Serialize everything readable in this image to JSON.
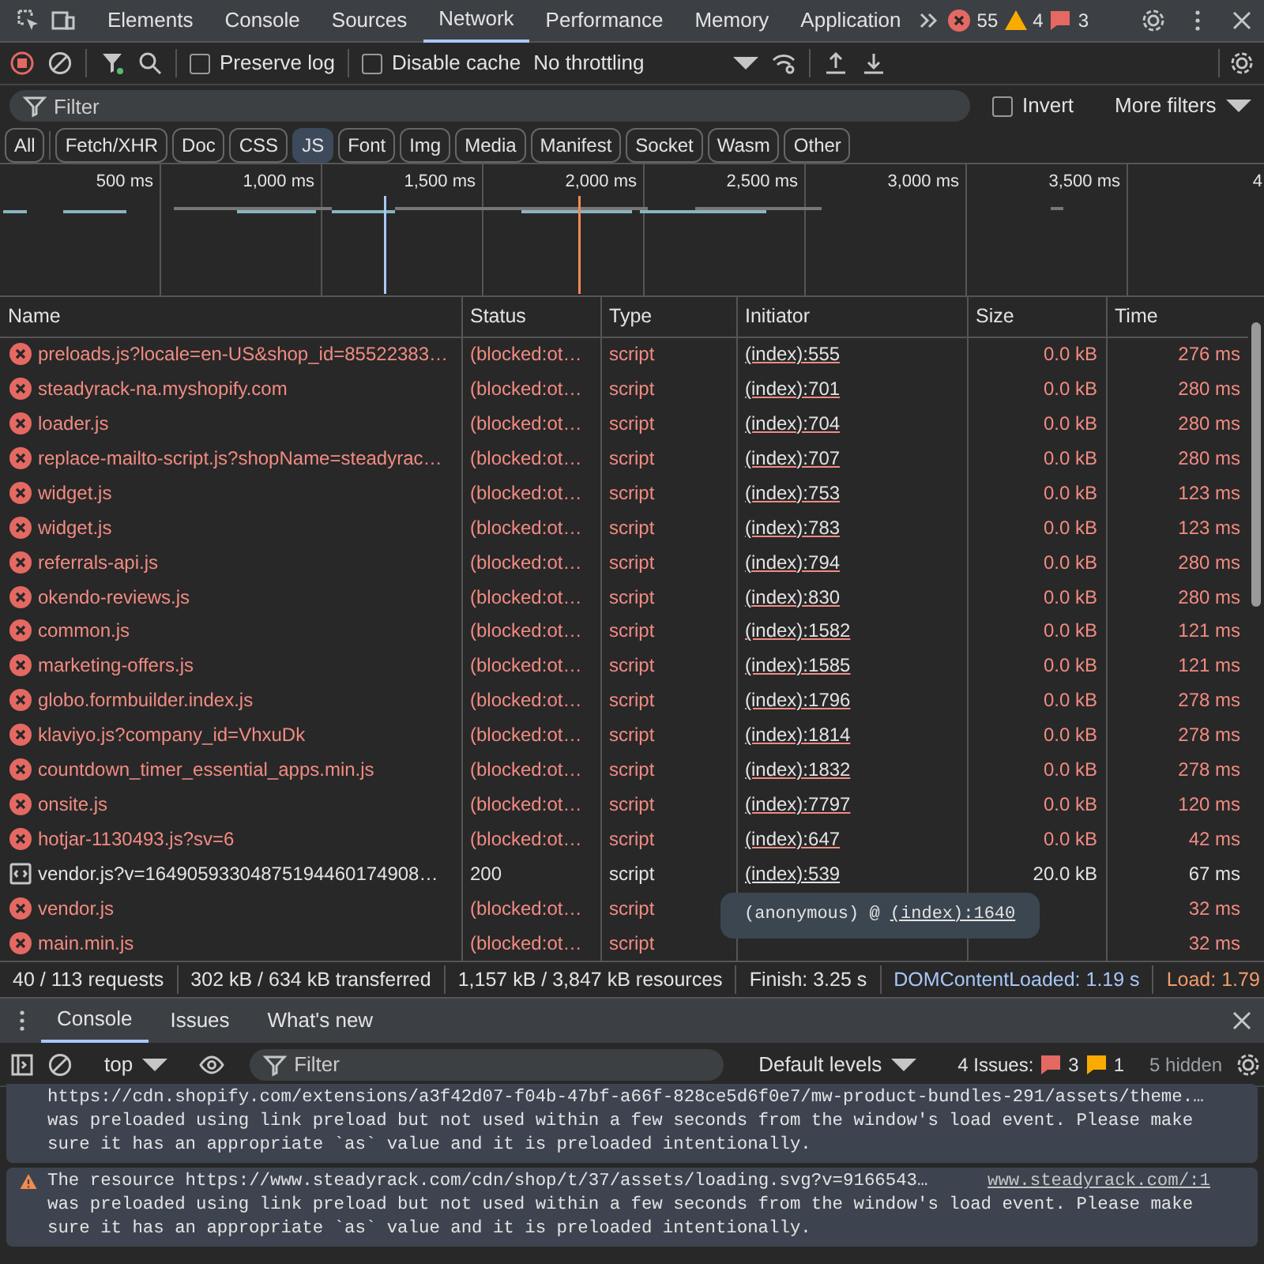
{
  "top_tabs": [
    {
      "label": "Elements",
      "selected": false
    },
    {
      "label": "Console",
      "selected": false
    },
    {
      "label": "Sources",
      "selected": false
    },
    {
      "label": "Network",
      "selected": true
    },
    {
      "label": "Performance",
      "selected": false
    },
    {
      "label": "Memory",
      "selected": false
    },
    {
      "label": "Application",
      "selected": false
    }
  ],
  "counts": {
    "errors": "55",
    "warnings": "4",
    "info": "3"
  },
  "toolbar": {
    "preserve_log": {
      "label": "Preserve log",
      "checked": false
    },
    "disable_cache": {
      "label": "Disable cache",
      "checked": false
    },
    "throttling": "No throttling"
  },
  "filter_bar": {
    "placeholder": "Filter",
    "invert": {
      "label": "Invert",
      "checked": false
    },
    "more_filters": "More filters"
  },
  "type_filters": [
    {
      "label": "All",
      "selected": false
    },
    {
      "label": "Fetch/XHR",
      "selected": false
    },
    {
      "label": "Doc",
      "selected": false
    },
    {
      "label": "CSS",
      "selected": false
    },
    {
      "label": "JS",
      "selected": true
    },
    {
      "label": "Font",
      "selected": false
    },
    {
      "label": "Img",
      "selected": false
    },
    {
      "label": "Media",
      "selected": false
    },
    {
      "label": "Manifest",
      "selected": false
    },
    {
      "label": "Socket",
      "selected": false
    },
    {
      "label": "Wasm",
      "selected": false
    },
    {
      "label": "Other",
      "selected": false
    }
  ],
  "overview": {
    "tick_labels": [
      "500 ms",
      "1,000 ms",
      "1,500 ms",
      "2,000 ms",
      "2,500 ms",
      "3,000 ms",
      "3,500 ms",
      "4"
    ]
  },
  "table": {
    "columns": [
      "Name",
      "Status",
      "Type",
      "Initiator",
      "Size",
      "Time"
    ],
    "rows": [
      {
        "kind": "error",
        "name": "preloads.js?locale=en-US&shop_id=85522383…",
        "status": "(blocked:ot…",
        "type": "script",
        "initiator": "(index):555",
        "size": "0.0 kB",
        "time": "276 ms"
      },
      {
        "kind": "error",
        "name": "steadyrack-na.myshopify.com",
        "status": "(blocked:ot…",
        "type": "script",
        "initiator": "(index):701",
        "size": "0.0 kB",
        "time": "280 ms"
      },
      {
        "kind": "error",
        "name": "loader.js",
        "status": "(blocked:ot…",
        "type": "script",
        "initiator": "(index):704",
        "size": "0.0 kB",
        "time": "280 ms"
      },
      {
        "kind": "error",
        "name": "replace-mailto-script.js?shopName=steadyrac…",
        "status": "(blocked:ot…",
        "type": "script",
        "initiator": "(index):707",
        "size": "0.0 kB",
        "time": "280 ms"
      },
      {
        "kind": "error",
        "name": "widget.js",
        "status": "(blocked:ot…",
        "type": "script",
        "initiator": "(index):753",
        "size": "0.0 kB",
        "time": "123 ms"
      },
      {
        "kind": "error",
        "name": "widget.js",
        "status": "(blocked:ot…",
        "type": "script",
        "initiator": "(index):783",
        "size": "0.0 kB",
        "time": "123 ms"
      },
      {
        "kind": "error",
        "name": "referrals-api.js",
        "status": "(blocked:ot…",
        "type": "script",
        "initiator": "(index):794",
        "size": "0.0 kB",
        "time": "280 ms"
      },
      {
        "kind": "error",
        "name": "okendo-reviews.js",
        "status": "(blocked:ot…",
        "type": "script",
        "initiator": "(index):830",
        "size": "0.0 kB",
        "time": "280 ms"
      },
      {
        "kind": "error",
        "name": "common.js",
        "status": "(blocked:ot…",
        "type": "script",
        "initiator": "(index):1582",
        "size": "0.0 kB",
        "time": "121 ms"
      },
      {
        "kind": "error",
        "name": "marketing-offers.js",
        "status": "(blocked:ot…",
        "type": "script",
        "initiator": "(index):1585",
        "size": "0.0 kB",
        "time": "121 ms"
      },
      {
        "kind": "error",
        "name": "globo.formbuilder.index.js",
        "status": "(blocked:ot…",
        "type": "script",
        "initiator": "(index):1796",
        "size": "0.0 kB",
        "time": "278 ms"
      },
      {
        "kind": "error",
        "name": "klaviyo.js?company_id=VhxuDk",
        "status": "(blocked:ot…",
        "type": "script",
        "initiator": "(index):1814",
        "size": "0.0 kB",
        "time": "278 ms"
      },
      {
        "kind": "error",
        "name": "countdown_timer_essential_apps.min.js",
        "status": "(blocked:ot…",
        "type": "script",
        "initiator": "(index):1832",
        "size": "0.0 kB",
        "time": "278 ms"
      },
      {
        "kind": "error",
        "name": "onsite.js",
        "status": "(blocked:ot…",
        "type": "script",
        "initiator": "(index):7797",
        "size": "0.0 kB",
        "time": "120 ms"
      },
      {
        "kind": "error",
        "name": "hotjar-1130493.js?sv=6",
        "status": "(blocked:ot…",
        "type": "script",
        "initiator": "(index):647",
        "size": "0.0 kB",
        "time": "42 ms"
      },
      {
        "kind": "script",
        "name": "vendor.js?v=16490593304875194460174908…",
        "status": "200",
        "type": "script",
        "initiator": "(index):539",
        "size": "20.0 kB",
        "time": "67 ms"
      },
      {
        "kind": "error",
        "name": "vendor.js",
        "status": "(blocked:ot…",
        "type": "script",
        "time": "32 ms"
      },
      {
        "kind": "error",
        "name": "main.min.js",
        "status": "(blocked:ot…",
        "type": "script",
        "time": "32 ms"
      }
    ]
  },
  "tooltip": {
    "text": "(anonymous) @",
    "link": "(index):1640"
  },
  "status_bar": [
    "40 / 113 requests",
    "302 kB / 634 kB transferred",
    "1,157 kB / 3,847 kB resources",
    "Finish: 3.25 s",
    "DOMContentLoaded: 1.19 s",
    "Load: 1.79"
  ],
  "drawer_tabs": [
    {
      "label": "Console",
      "selected": true
    },
    {
      "label": "Issues",
      "selected": false
    },
    {
      "label": "What's new",
      "selected": false
    }
  ],
  "console_toolbar": {
    "context": "top",
    "placeholder": "Filter",
    "levels": "Default levels",
    "issues_label": "4 Issues:",
    "issue_errors": "3",
    "issue_warnings": "1",
    "hidden": "5 hidden"
  },
  "messages": [
    {
      "kind": "continued",
      "url": "https://cdn.shopify.com/extensions/a3f42d07-f04b-47bf-a66f-828ce5d6f0e7/mw-product-bundles-291/assets/theme.…",
      "text": "was preloaded using link preload but not used within a few seconds from the window's load event. Please make sure it has an appropriate `as` value and it is preloaded intentionally."
    },
    {
      "kind": "warning",
      "prefix": "The resource",
      "url": "https://www.steadyrack.com/cdn/shop/t/37/assets/loading.svg?v=9166543…",
      "source": "www.steadyrack.com/:1",
      "text": "was preloaded using link preload but not used within a few seconds from the window's load event. Please make sure it has an appropriate `as` value and it is preloaded intentionally."
    }
  ]
}
